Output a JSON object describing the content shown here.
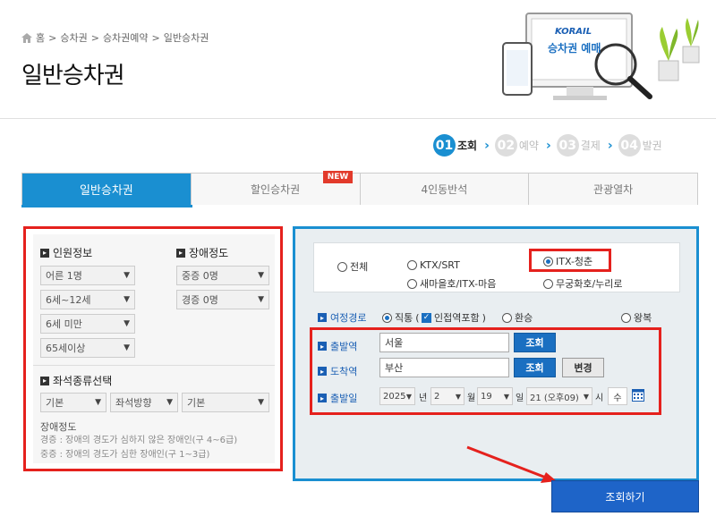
{
  "breadcrumb": {
    "home": "홈",
    "items": [
      "승차권",
      "승차권예약",
      "일반승차권"
    ]
  },
  "page_title": "일반승차권",
  "illustration": {
    "brand": "KORAIL",
    "screen_text": "승차권 예매"
  },
  "steps": [
    {
      "num": "01",
      "label": "조회"
    },
    {
      "num": "02",
      "label": "예약"
    },
    {
      "num": "03",
      "label": "결제"
    },
    {
      "num": "04",
      "label": "발권"
    }
  ],
  "tabs": [
    "일반승차권",
    "할인승차권",
    "4인동반석",
    "관광열차"
  ],
  "tab_badge": "NEW",
  "passengers": {
    "title": "인원정보",
    "adult": "어른 1명",
    "child": "6세~12세",
    "infant": "6세 미만",
    "senior": "65세이상"
  },
  "disability": {
    "title": "장애정도",
    "severe": "중증 0명",
    "mild": "경증 0명"
  },
  "seat": {
    "title": "좌석종류선택",
    "type": "기본",
    "direction": "좌석방향",
    "position": "기본"
  },
  "disability_note": {
    "title": "장애정도",
    "mild": "경증 : 장애의 경도가 심하지 않은 장애인(구 4~6급)",
    "severe": "중증 : 장애의 경도가 심한 장애인(구 1~3급)"
  },
  "train_types": {
    "all": "전체",
    "ktx": "KTX/SRT",
    "itx_cheongchun": "ITX-청춘",
    "saemaeul": "새마을호/ITX-마음",
    "mugunghwa": "무궁화호/누리로"
  },
  "route": {
    "label": "여정경로",
    "direct": "직통",
    "include_nearby": "인접역포함",
    "transfer": "환승",
    "round_trip": "왕복"
  },
  "departure": {
    "label": "출발역",
    "value": "서울",
    "search_btn": "조회"
  },
  "arrival": {
    "label": "도착역",
    "value": "부산",
    "search_btn": "조회",
    "swap_btn": "변경"
  },
  "date": {
    "label": "출발일",
    "year": "2025",
    "year_unit": "년",
    "month": "2",
    "month_unit": "월",
    "day": "19",
    "day_unit": "일",
    "hour": "21 (오후09)",
    "hour_unit": "시",
    "weekday": "수"
  },
  "submit_label": "조회하기",
  "colors": {
    "accent": "#1a8fd1",
    "highlight": "#e5211d",
    "submit": "#1e64c8"
  }
}
